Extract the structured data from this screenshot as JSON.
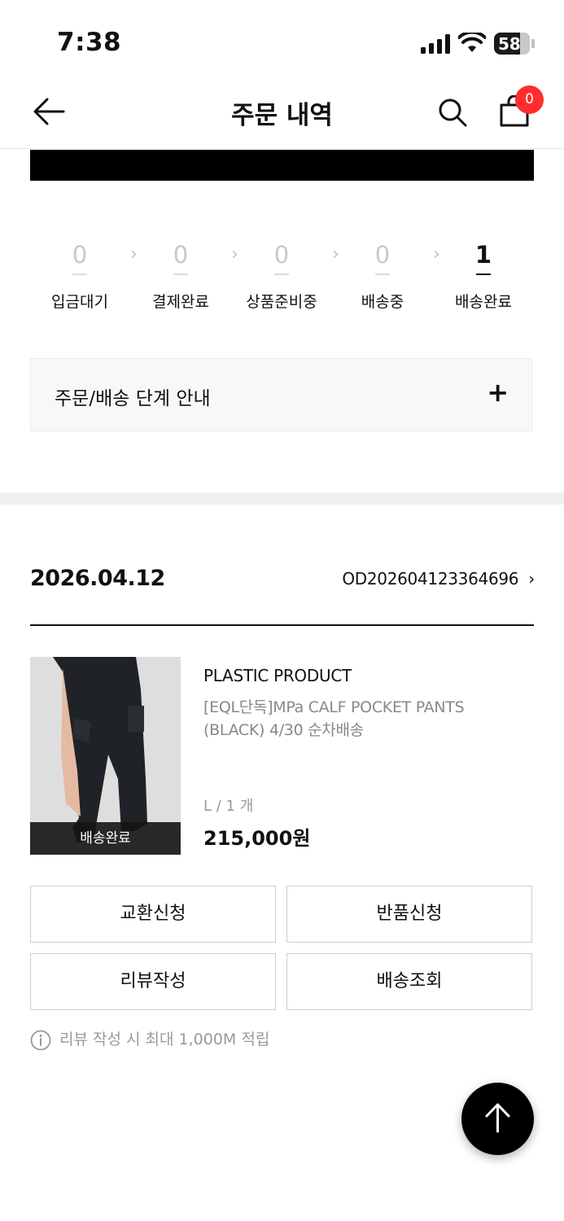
{
  "status_bar": {
    "time": "7:38",
    "battery": "58"
  },
  "header": {
    "title": "주문 내역",
    "cart_count": "0"
  },
  "steps": [
    {
      "count": "0",
      "label": "입금대기",
      "active": false
    },
    {
      "count": "0",
      "label": "결제완료",
      "active": false
    },
    {
      "count": "0",
      "label": "상품준비중",
      "active": false
    },
    {
      "count": "0",
      "label": "배송중",
      "active": false
    },
    {
      "count": "1",
      "label": "배송완료",
      "active": true
    }
  ],
  "guide": {
    "label": "주문/배송 단계 안내",
    "toggle": "+"
  },
  "order": {
    "date": "2026.04.12",
    "number": "OD202604123364696",
    "item": {
      "status": "배송완료",
      "brand": "PLASTIC PRODUCT",
      "name": "[EQL단독]MPa CALF POCKET PANTS (BLACK) 4/30 순차배송",
      "option": "L / 1 개",
      "price": "215,000원"
    }
  },
  "actions": {
    "exchange": "교환신청",
    "return": "반품신청",
    "review": "리뷰작성",
    "tracking": "배송조회"
  },
  "notice": "리뷰 작성 시 최대 1,000M 적립",
  "icons": [
    "back-arrow-icon",
    "search-icon",
    "shopping-bag-icon",
    "info-icon",
    "arrow-up-icon"
  ],
  "colors": {
    "badge": "#ff2d2d",
    "primary": "#000000"
  }
}
